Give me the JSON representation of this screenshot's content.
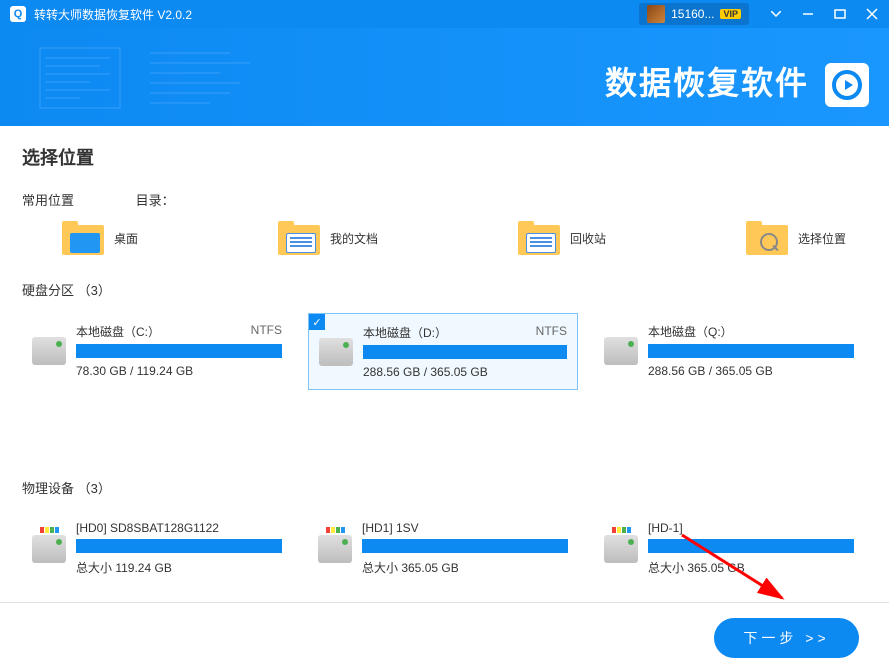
{
  "titlebar": {
    "app_title": "转转大师数据恢复软件 V2.0.2",
    "username": "15160...",
    "vip_label": "VIP"
  },
  "banner": {
    "title": "数据恢复软件"
  },
  "main": {
    "heading": "选择位置",
    "common_label": "常用位置",
    "dir_label": "目录：",
    "locations": [
      {
        "label": "桌面"
      },
      {
        "label": "我的文档"
      },
      {
        "label": "回收站"
      },
      {
        "label": "选择位置"
      }
    ],
    "partitions_title": "硬盘分区 （3）",
    "partitions": [
      {
        "name": "本地磁盘（C:）",
        "fs": "NTFS",
        "size": "78.30 GB / 119.24 GB",
        "used_pct": 100,
        "selected": false
      },
      {
        "name": "本地磁盘（D:）",
        "fs": "NTFS",
        "size": "288.56 GB / 365.05 GB",
        "used_pct": 100,
        "selected": true
      },
      {
        "name": "本地磁盘（Q:）",
        "fs": "",
        "size": "288.56 GB / 365.05 GB",
        "used_pct": 100,
        "selected": false
      }
    ],
    "devices_title": "物理设备 （3）",
    "devices": [
      {
        "name": "[HD0] SD8SBAT128G1122",
        "size": "总大小 119.24 GB"
      },
      {
        "name": "[HD1] 1SV",
        "size": "总大小 365.05 GB"
      },
      {
        "name": "[HD-1]",
        "size": "总大小 365.05 GB"
      }
    ]
  },
  "footer": {
    "next_label": "下一步 >>"
  }
}
